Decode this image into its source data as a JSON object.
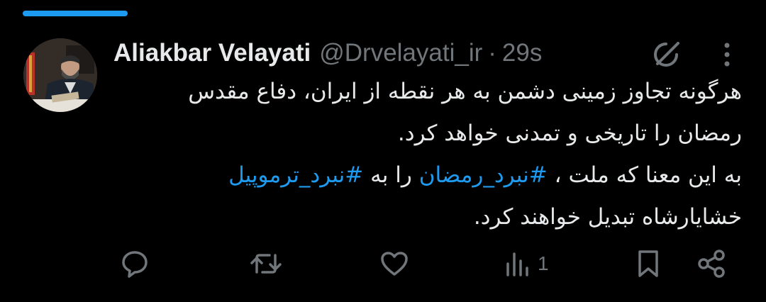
{
  "tweet": {
    "author_name": "Aliakbar Velayati",
    "handle": "@Drvelayati_ir",
    "separator": "·",
    "time": "29s",
    "text_lines": [
      "هرگونه تجاوز زمینی دشمن به هر نقطه از ایران، دفاع مقدس",
      "رمضان را تاریخی و تمدنی خواهد کرد.",
      "خشایارشاه تبدیل خواهند کرد."
    ],
    "line3_part1": "به این معنا که ملت ، ",
    "hashtag1": "#نبرد_رمضان",
    "line3_part2": " را به ",
    "hashtag2": "#نبرد_ترموپیل",
    "views_count": "1"
  },
  "icons": {
    "reply": "reply-icon",
    "retweet": "retweet-icon",
    "like": "like-icon",
    "views": "views-icon",
    "bookmark": "bookmark-icon",
    "share": "share-icon",
    "grok": "grok-icon",
    "more": "more-icon"
  },
  "colors": {
    "background": "#000000",
    "text": "#e7e9ea",
    "secondary": "#71767b",
    "accent": "#1d9bf0"
  }
}
